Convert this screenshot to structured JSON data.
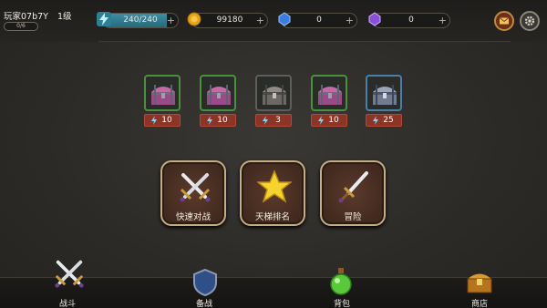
{
  "player": {
    "name": "玩家07b7Y",
    "level": "1级",
    "exp": "0/6"
  },
  "resources": {
    "energy": "240/240",
    "energy_fill": 1.0,
    "coins": "99180",
    "blue_gems": "0",
    "purple_gems": "0",
    "plus": "+"
  },
  "colors": {
    "energy": "#2d7f93",
    "coin": "#e5a21a",
    "blue_gem": "#3a7de0",
    "purple_gem": "#8a4fd8",
    "cost_bg": "#8c3526"
  },
  "chests": [
    {
      "type": "pink",
      "cost": "10"
    },
    {
      "type": "pink",
      "cost": "10"
    },
    {
      "type": "grey",
      "cost": "3"
    },
    {
      "type": "pink",
      "cost": "10"
    },
    {
      "type": "blue",
      "cost": "25"
    }
  ],
  "modes": [
    {
      "label": "快速对战",
      "icon": "crossed-swords-icon"
    },
    {
      "label": "天梯排名",
      "icon": "star-icon"
    },
    {
      "label": "冒险",
      "icon": "sword-icon"
    }
  ],
  "nav": [
    {
      "label": "战斗",
      "icon": "crossed-swords-icon"
    },
    {
      "label": "备战",
      "icon": "shield-icon"
    },
    {
      "label": "背包",
      "icon": "potion-icon"
    },
    {
      "label": "商店",
      "icon": "treasure-chest-icon"
    }
  ]
}
